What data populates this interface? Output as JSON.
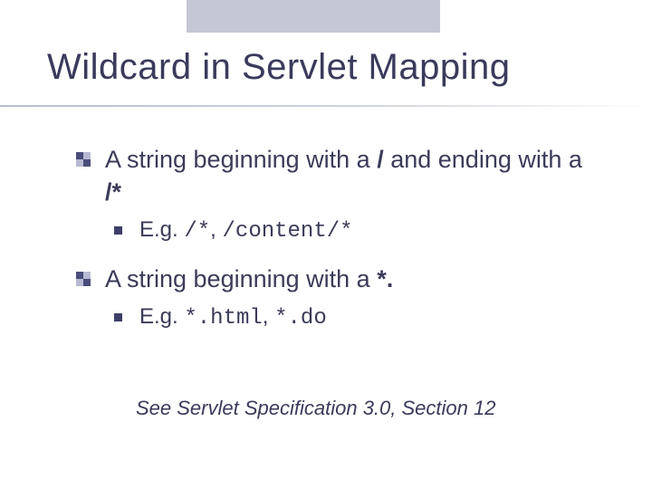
{
  "slide": {
    "title": "Wildcard in Servlet Mapping",
    "bullets": [
      {
        "text_parts": {
          "a": "A string beginning with a ",
          "b": "/",
          "c": " and ending with a ",
          "d": "/*"
        },
        "sub": {
          "prefix": "E.g. ",
          "code1": "/*",
          "sep": ", ",
          "code2": "/content/*"
        }
      },
      {
        "text_parts": {
          "a": "A string beginning with a ",
          "b": "*."
        },
        "sub": {
          "prefix": "E.g. ",
          "code1": "*.html",
          "sep": ", ",
          "code2": "*.do"
        }
      }
    ],
    "footer": "See Servlet Specification 3.0, Section 12"
  }
}
